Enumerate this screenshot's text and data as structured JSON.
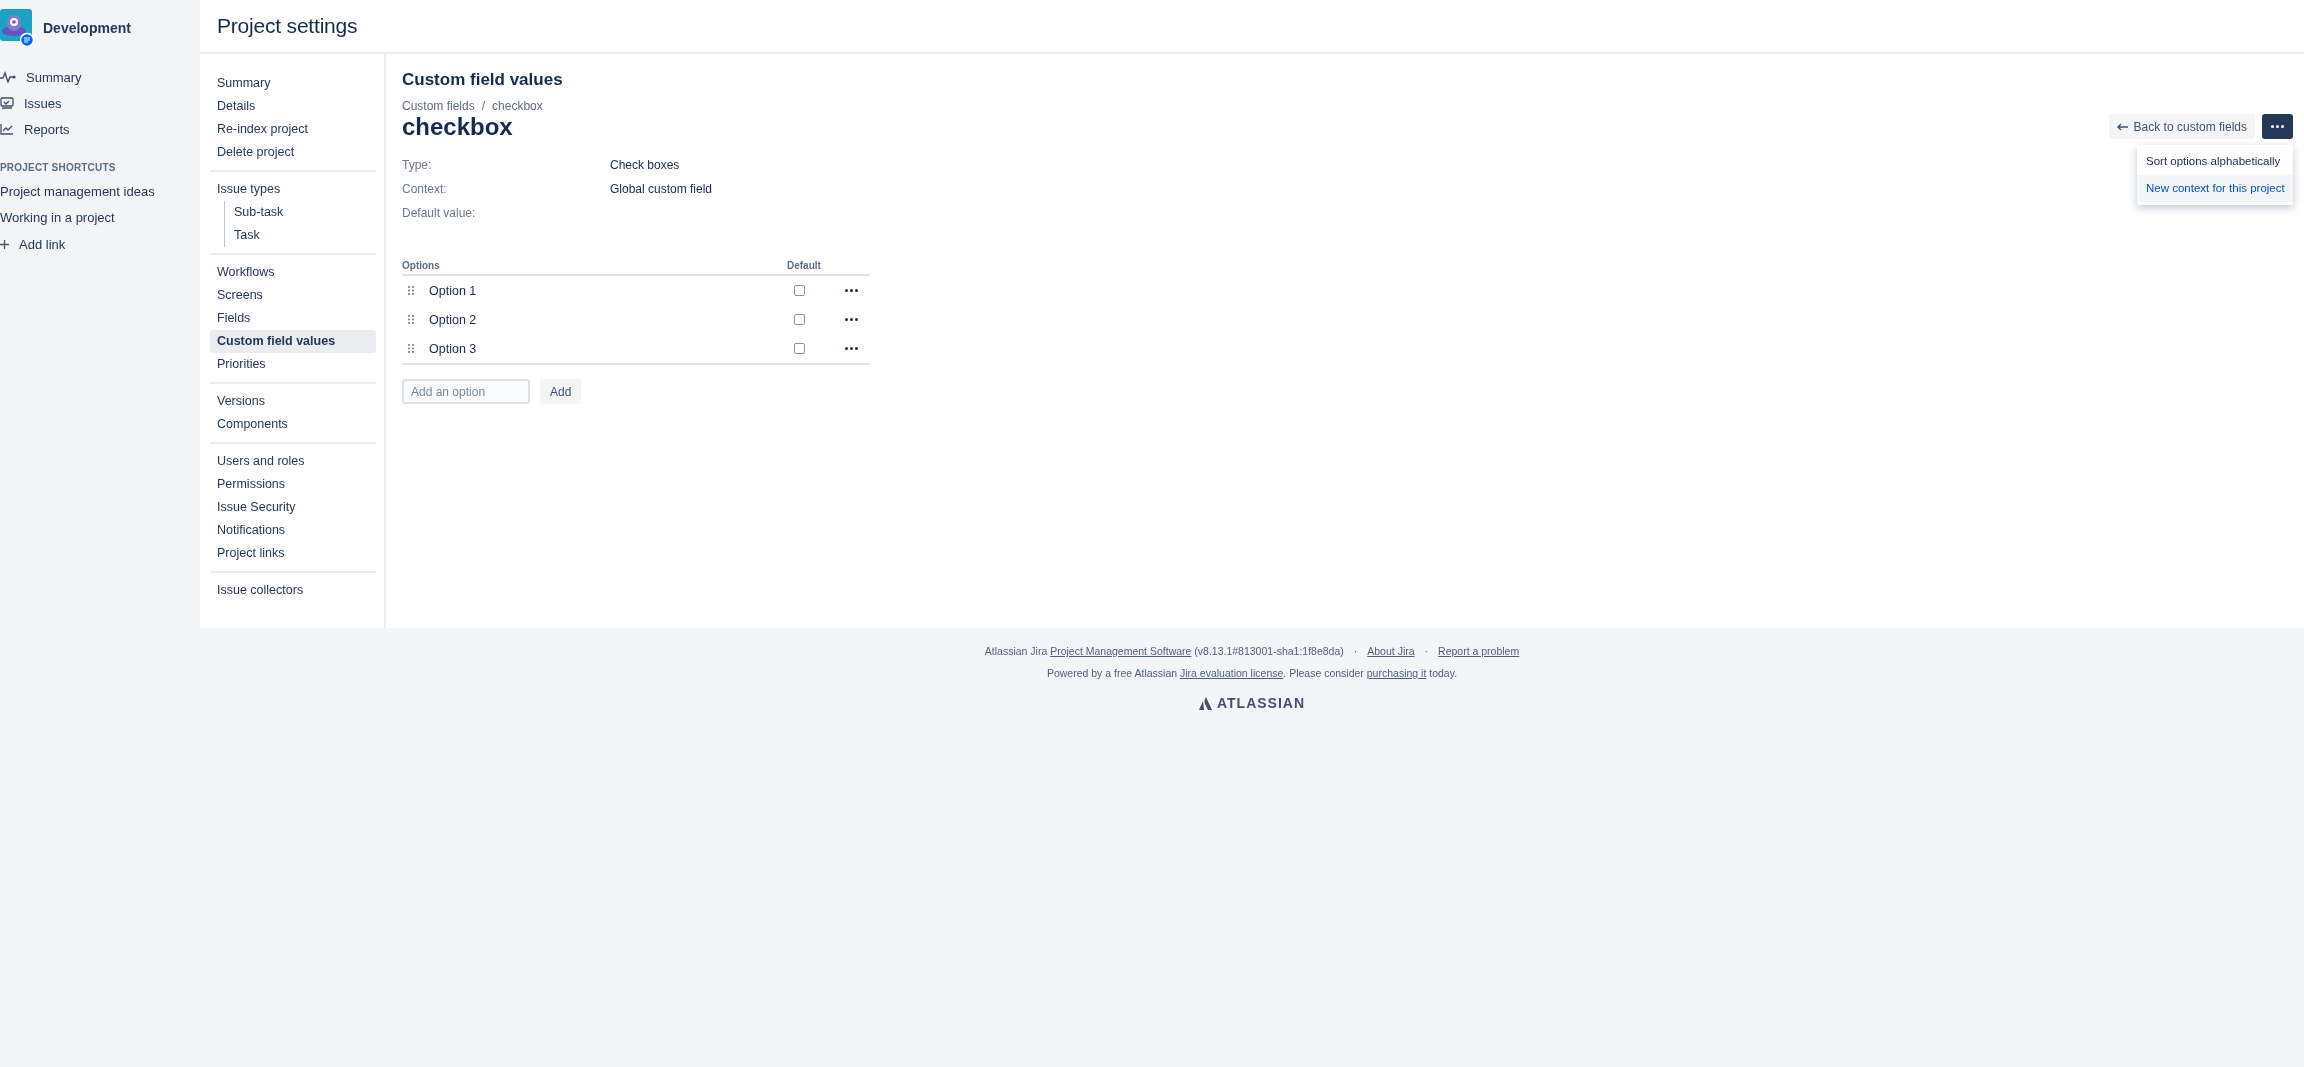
{
  "sidebar": {
    "project_name": "Development",
    "nav": [
      {
        "label": "Summary"
      },
      {
        "label": "Issues"
      },
      {
        "label": "Reports"
      }
    ],
    "shortcuts_heading": "PROJECT SHORTCUTS",
    "shortcuts": [
      "Project management ideas",
      "Working in a project"
    ],
    "add_link": "Add link"
  },
  "header": {
    "title": "Project settings"
  },
  "settings_nav": [
    [
      {
        "label": "Summary",
        "selected": false
      },
      {
        "label": "Details",
        "selected": false
      },
      {
        "label": "Re-index project",
        "selected": false
      },
      {
        "label": "Delete project",
        "selected": false
      }
    ],
    [
      {
        "label": "Issue types",
        "selected": false,
        "children": [
          {
            "label": "Sub-task",
            "selected": false
          },
          {
            "label": "Task",
            "selected": false
          }
        ]
      }
    ],
    [
      {
        "label": "Workflows",
        "selected": false
      },
      {
        "label": "Screens",
        "selected": false
      },
      {
        "label": "Fields",
        "selected": false
      },
      {
        "label": "Custom field values",
        "selected": true
      },
      {
        "label": "Priorities",
        "selected": false
      }
    ],
    [
      {
        "label": "Versions",
        "selected": false
      },
      {
        "label": "Components",
        "selected": false
      }
    ],
    [
      {
        "label": "Users and roles",
        "selected": false
      },
      {
        "label": "Permissions",
        "selected": false
      },
      {
        "label": "Issue Security",
        "selected": false
      },
      {
        "label": "Notifications",
        "selected": false
      },
      {
        "label": "Project links",
        "selected": false
      }
    ],
    [
      {
        "label": "Issue collectors",
        "selected": false
      }
    ]
  ],
  "content": {
    "title": "Custom field values",
    "breadcrumb": {
      "items": [
        "Custom fields",
        "checkbox"
      ],
      "separator": "/"
    },
    "heading": "checkbox",
    "back_button": "Back to custom fields",
    "menu": {
      "items": [
        {
          "label": "Sort options alphabetically",
          "selected": false
        },
        {
          "label": "New context for this project",
          "selected": true
        }
      ]
    },
    "details": [
      {
        "label": "Type:",
        "value": "Check boxes"
      },
      {
        "label": "Context:",
        "value": "Global custom field"
      },
      {
        "label": "Default value:"
      }
    ],
    "options_table": {
      "columns": [
        "Options",
        "Default"
      ],
      "rows": [
        {
          "label": "Option 1",
          "checked": false
        },
        {
          "label": "Option 2",
          "checked": false
        },
        {
          "label": "Option 3",
          "checked": false
        }
      ]
    },
    "add_field": {
      "placeholder": "Add an option"
    },
    "add_button": "Add"
  },
  "footer": {
    "line_1": [
      {
        "kind": "text",
        "text": "Atlassian Jira "
      },
      {
        "kind": "link",
        "text": "Project Management Software"
      },
      {
        "kind": "text",
        "text": " (v8.13.1#813001-sha1:1f8e8da)"
      },
      {
        "kind": "separator",
        "text": "·"
      },
      {
        "kind": "link",
        "text": "About Jira"
      },
      {
        "kind": "separator",
        "text": "·"
      },
      {
        "kind": "link",
        "text": "Report a problem"
      }
    ],
    "line_2": [
      {
        "kind": "text",
        "text": "Powered by a free Atlassian "
      },
      {
        "kind": "link",
        "text": "Jira evaluation license"
      },
      {
        "kind": "text",
        "text": ". Please consider "
      },
      {
        "kind": "link",
        "text": "purchasing it"
      },
      {
        "kind": "text",
        "text": " today."
      }
    ],
    "logo": "ATLASSIAN"
  }
}
